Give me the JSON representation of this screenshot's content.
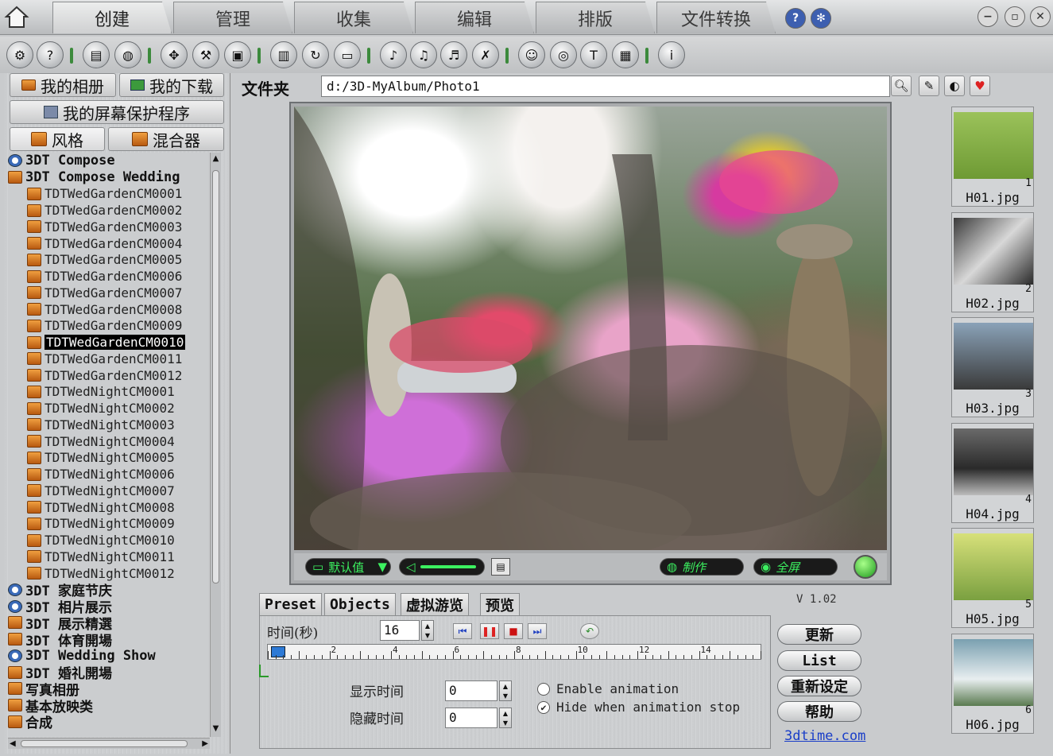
{
  "main_tabs": [
    "创建",
    "管理",
    "收集",
    "编辑",
    "排版",
    "文件转换"
  ],
  "left": {
    "my_album": "我的相册",
    "my_download": "我的下载",
    "screensaver": "我的屏幕保护程序",
    "style_tab": "风格",
    "mixer_tab": "混合器",
    "tree_top": [
      {
        "label": "3DT Compose",
        "icon": "clock-icon"
      },
      {
        "label": "3DT Compose Wedding",
        "icon": "box-icon"
      }
    ],
    "tree_children": [
      "TDTWedGardenCM0001",
      "TDTWedGardenCM0002",
      "TDTWedGardenCM0003",
      "TDTWedGardenCM0004",
      "TDTWedGardenCM0005",
      "TDTWedGardenCM0006",
      "TDTWedGardenCM0007",
      "TDTWedGardenCM0008",
      "TDTWedGardenCM0009",
      "TDTWedGardenCM0010",
      "TDTWedGardenCM0011",
      "TDTWedGardenCM0012",
      "TDTWedNightCM0001",
      "TDTWedNightCM0002",
      "TDTWedNightCM0003",
      "TDTWedNightCM0004",
      "TDTWedNightCM0005",
      "TDTWedNightCM0006",
      "TDTWedNightCM0007",
      "TDTWedNightCM0008",
      "TDTWedNightCM0009",
      "TDTWedNightCM0010",
      "TDTWedNightCM0011",
      "TDTWedNightCM0012"
    ],
    "selected_child": "TDTWedGardenCM0010",
    "tree_bottom": [
      {
        "label": "3DT 家庭节庆",
        "icon": "clock-icon"
      },
      {
        "label": "3DT 相片展示",
        "icon": "clock-icon"
      },
      {
        "label": "3DT 展示精選",
        "icon": "box-icon"
      },
      {
        "label": "3DT 体育開場",
        "icon": "box-icon"
      },
      {
        "label": "3DT Wedding Show",
        "icon": "clock-icon"
      },
      {
        "label": "3DT 婚礼開場",
        "icon": "box-icon"
      },
      {
        "label": "写真相册",
        "icon": "box-icon"
      },
      {
        "label": "基本放映类",
        "icon": "box-icon"
      },
      {
        "label": "合成",
        "icon": "box-icon"
      }
    ]
  },
  "folder": {
    "label": "文件夹",
    "path": "d:/3D-MyAlbum/Photo1"
  },
  "preview": {
    "default_label": "默认值",
    "make_label": "制作",
    "fullscreen_label": "全屏"
  },
  "sub_tabs": [
    "Preset",
    "Objects",
    "虚拟游览",
    "预览"
  ],
  "version": "V 1.02",
  "timing": {
    "time_label": "时间(秒)",
    "time_value": "16",
    "ruler_labels": [
      "2",
      "4",
      "6",
      "8",
      "10",
      "12",
      "14"
    ],
    "show_time_label": "显示时间",
    "show_time_value": "0",
    "hide_time_label": "隐藏时间",
    "hide_time_value": "0",
    "enable_animation": "Enable animation",
    "hide_when_stop": "Hide when animation stop"
  },
  "side_buttons": {
    "update": "更新",
    "list": "List",
    "reset": "重新设定",
    "help": "帮助",
    "link": "3dtime.com"
  },
  "thumbnails": [
    {
      "name": "H01.jpg",
      "num": "1"
    },
    {
      "name": "H02.jpg",
      "num": "2"
    },
    {
      "name": "H03.jpg",
      "num": "3"
    },
    {
      "name": "H04.jpg",
      "num": "4"
    },
    {
      "name": "H05.jpg",
      "num": "5"
    },
    {
      "name": "H06.jpg",
      "num": "6"
    }
  ],
  "toolbar_icons": [
    "settings-icon",
    "help-icon",
    "album-icon",
    "globe-icon",
    "move-icon",
    "tools-icon",
    "photo-icon",
    "film-icon",
    "refresh-icon",
    "folder-icon",
    "music-icon",
    "music-add-icon",
    "music-edit-icon",
    "music-delete-icon",
    "user-icon",
    "chat-icon",
    "text-icon",
    "frame-icon",
    "info-icon"
  ],
  "colors": {
    "accent_green": "#3cf060",
    "link": "#1a3ec8",
    "selection": "#000000"
  }
}
